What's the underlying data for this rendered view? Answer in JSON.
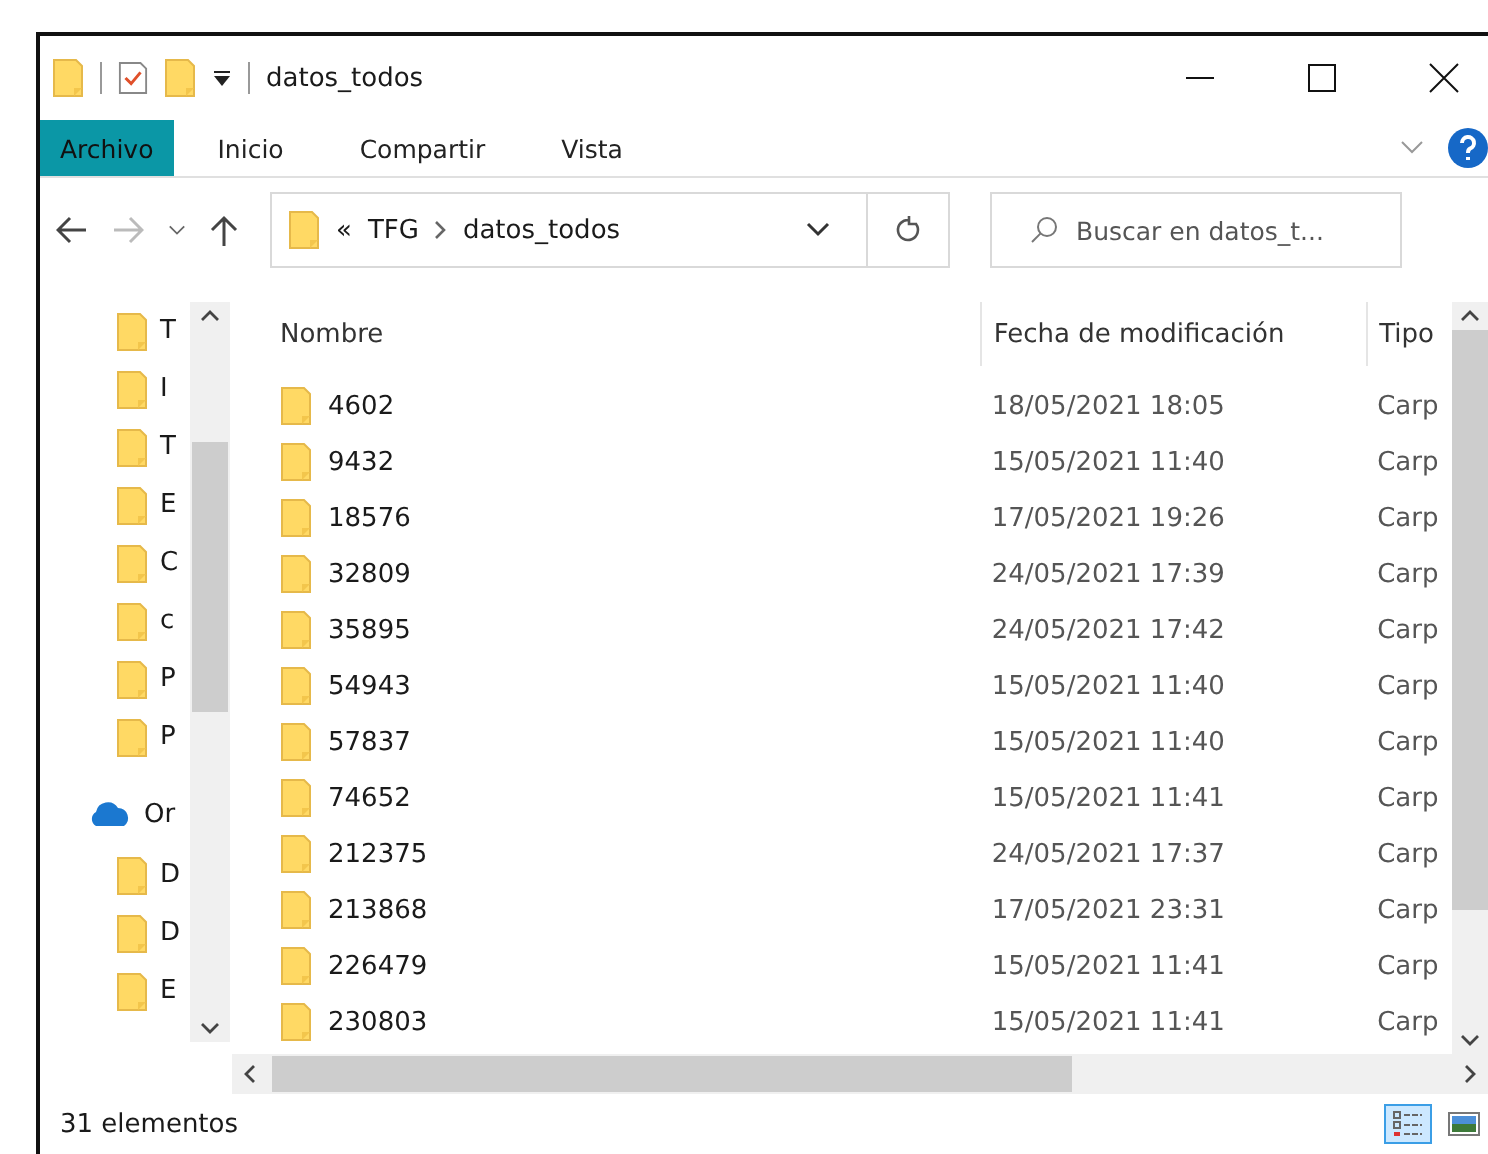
{
  "window": {
    "title": "datos_todos"
  },
  "ribbon_tabs": [
    {
      "label": "Archivo",
      "selected": true
    },
    {
      "label": "Inicio",
      "selected": false
    },
    {
      "label": "Compartir",
      "selected": false
    },
    {
      "label": "Vista",
      "selected": false
    }
  ],
  "address": {
    "overflow": "«",
    "crumbs": [
      "TFG",
      "datos_todos"
    ]
  },
  "search": {
    "placeholder": "Buscar en datos_t..."
  },
  "sidebar": {
    "items": [
      {
        "kind": "folder",
        "label": "T"
      },
      {
        "kind": "folder",
        "label": "I"
      },
      {
        "kind": "folder",
        "label": "T"
      },
      {
        "kind": "folder",
        "label": "E"
      },
      {
        "kind": "folder",
        "label": "C"
      },
      {
        "kind": "folder",
        "label": "c"
      },
      {
        "kind": "folder",
        "label": "P"
      },
      {
        "kind": "folder",
        "label": "P"
      },
      {
        "kind": "cloud",
        "label": "Or"
      },
      {
        "kind": "folder",
        "label": "D"
      },
      {
        "kind": "folder",
        "label": "D"
      },
      {
        "kind": "folder",
        "label": "E"
      }
    ]
  },
  "table": {
    "columns": [
      "Nombre",
      "Fecha de modificación",
      "Tipo"
    ],
    "rows": [
      [
        "4602",
        "18/05/2021 18:05",
        "Carp"
      ],
      [
        "9432",
        "15/05/2021 11:40",
        "Carp"
      ],
      [
        "18576",
        "17/05/2021 19:26",
        "Carp"
      ],
      [
        "32809",
        "24/05/2021 17:39",
        "Carp"
      ],
      [
        "35895",
        "24/05/2021 17:42",
        "Carp"
      ],
      [
        "54943",
        "15/05/2021 11:40",
        "Carp"
      ],
      [
        "57837",
        "15/05/2021 11:40",
        "Carp"
      ],
      [
        "74652",
        "15/05/2021 11:41",
        "Carp"
      ],
      [
        "212375",
        "24/05/2021 17:37",
        "Carp"
      ],
      [
        "213868",
        "17/05/2021 23:31",
        "Carp"
      ],
      [
        "226479",
        "15/05/2021 11:41",
        "Carp"
      ],
      [
        "230803",
        "15/05/2021 11:41",
        "Carp"
      ]
    ]
  },
  "status_bar": {
    "count": "31 elementos"
  },
  "views": [
    {
      "kind": "details",
      "selected": true
    },
    {
      "kind": "large",
      "selected": false
    }
  ]
}
